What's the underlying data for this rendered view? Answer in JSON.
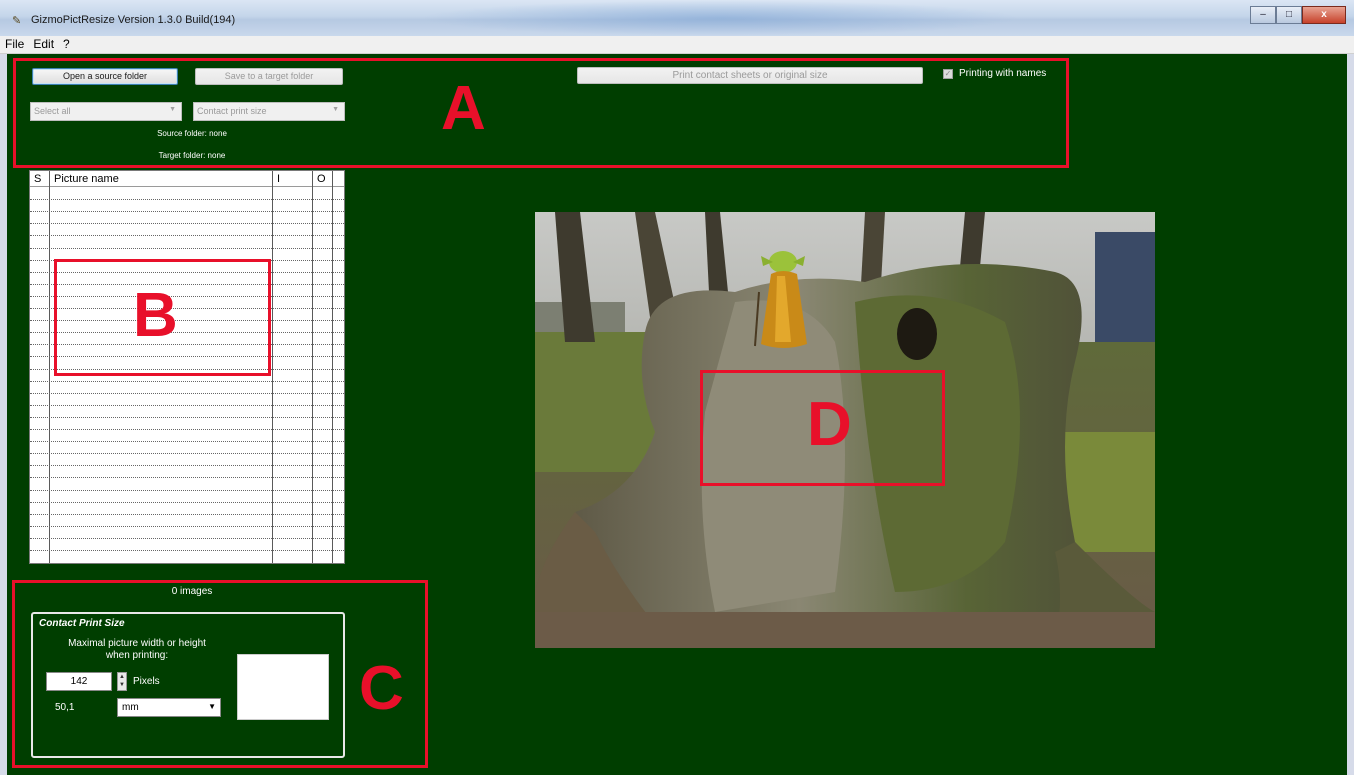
{
  "window": {
    "title": "GizmoPictResize  Version 1.3.0 Build(194)",
    "minimize": "–",
    "maximize": "□",
    "close": "x"
  },
  "menu": [
    "File",
    "Edit",
    "?"
  ],
  "toolbar": {
    "open_source": "Open a source folder",
    "save_target": "Save to a target folder",
    "print_contact": "Print contact sheets or original size",
    "printing_with_names": "Printing with names",
    "select_all": "Select all",
    "contact_print_size": "Contact print size",
    "source_folder": "Source folder: none",
    "target_folder": "Target folder: none"
  },
  "table": {
    "columns": [
      "S",
      "Picture name",
      "I",
      "O"
    ],
    "rows": 20
  },
  "image_count": "0 images",
  "contact_print": {
    "title": "Contact Print Size",
    "description_line1": "Maximal picture width or height",
    "description_line2": "when printing:",
    "value": "142",
    "unit_pixels": "Pixels",
    "mm_value": "50,1",
    "unit_select": "mm"
  },
  "annotations": {
    "A": "A",
    "B": "B",
    "C": "C",
    "D": "D",
    "color": "#e8102a"
  },
  "colors": {
    "background": "#003e00"
  }
}
